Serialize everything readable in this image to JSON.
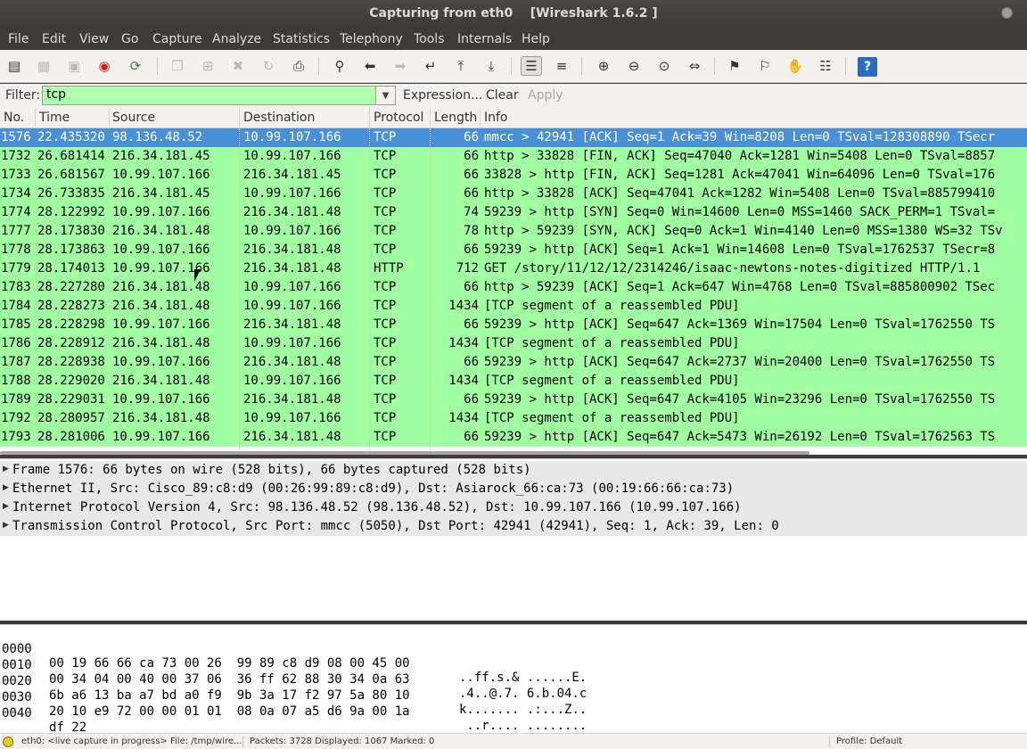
{
  "window": {
    "title": "Capturing from eth0    [Wireshark 1.6.2 ]"
  },
  "menu": [
    "File",
    "Edit",
    "View",
    "Go",
    "Capture",
    "Analyze",
    "Statistics",
    "Telephony",
    "Tools",
    "Internals",
    "Help"
  ],
  "toolbar": {
    "icons": [
      "interfaces-icon",
      "options-icon",
      "start-icon",
      "stop-icon",
      "restart-icon",
      "open-icon",
      "save-icon",
      "close-icon",
      "reload-icon",
      "print-icon",
      "find-icon",
      "back-icon",
      "forward-icon",
      "goto-icon",
      "first-icon",
      "last-icon",
      "colorize-icon",
      "autoscroll-icon",
      "zoom-in-icon",
      "zoom-out-icon",
      "zoom-normal-icon",
      "resize-columns-icon",
      "capture-filters-icon",
      "display-filters-icon",
      "coloring-rules-icon",
      "preferences-icon",
      "help-icon"
    ],
    "help_glyph": "?"
  },
  "filter": {
    "label": "Filter:",
    "value": "tcp",
    "expression": "Expression...",
    "clear": "Clear",
    "apply": "Apply"
  },
  "columns": [
    "No.",
    "Time",
    "Source",
    "Destination",
    "Protocol",
    "Length",
    "Info"
  ],
  "packets": [
    {
      "no": "1576",
      "time": "22.435320",
      "src": "98.136.48.52",
      "dst": "10.99.107.166",
      "proto": "TCP",
      "len": "66",
      "info": "mmcc > 42941 [ACK] Seq=1 Ack=39 Win=8208 Len=0 TSval=128308890 TSecr",
      "selected": true
    },
    {
      "no": "1732",
      "time": "26.681414",
      "src": "216.34.181.45",
      "dst": "10.99.107.166",
      "proto": "TCP",
      "len": "66",
      "info": "http > 33828 [FIN, ACK] Seq=47040 Ack=1281 Win=5408 Len=0 TSval=8857"
    },
    {
      "no": "1733",
      "time": "26.681567",
      "src": "10.99.107.166",
      "dst": "216.34.181.45",
      "proto": "TCP",
      "len": "66",
      "info": "33828 > http [FIN, ACK] Seq=1281 Ack=47041 Win=64096 Len=0 TSval=176"
    },
    {
      "no": "1734",
      "time": "26.733835",
      "src": "216.34.181.45",
      "dst": "10.99.107.166",
      "proto": "TCP",
      "len": "66",
      "info": "http > 33828 [ACK] Seq=47041 Ack=1282 Win=5408 Len=0 TSval=885799410"
    },
    {
      "no": "1774",
      "time": "28.122992",
      "src": "10.99.107.166",
      "dst": "216.34.181.48",
      "proto": "TCP",
      "len": "74",
      "info": "59239 > http [SYN] Seq=0 Win=14600 Len=0 MSS=1460 SACK_PERM=1 TSval="
    },
    {
      "no": "1777",
      "time": "28.173830",
      "src": "216.34.181.48",
      "dst": "10.99.107.166",
      "proto": "TCP",
      "len": "78",
      "info": "http > 59239 [SYN, ACK] Seq=0 Ack=1 Win=4140 Len=0 MSS=1380 WS=32 TSv"
    },
    {
      "no": "1778",
      "time": "28.173863",
      "src": "10.99.107.166",
      "dst": "216.34.181.48",
      "proto": "TCP",
      "len": "66",
      "info": "59239 > http [ACK] Seq=1 Ack=1 Win=14608 Len=0 TSval=1762537 TSecr=8"
    },
    {
      "no": "1779",
      "time": "28.174013",
      "src": "10.99.107.166",
      "dst": "216.34.181.48",
      "proto": "HTTP",
      "len": "712",
      "info": "GET /story/11/12/12/2314246/isaac-newtons-notes-digitized HTTP/1.1"
    },
    {
      "no": "1783",
      "time": "28.227280",
      "src": "216.34.181.48",
      "dst": "10.99.107.166",
      "proto": "TCP",
      "len": "66",
      "info": "http > 59239 [ACK] Seq=1 Ack=647 Win=4768 Len=0 TSval=885800902 TSec"
    },
    {
      "no": "1784",
      "time": "28.228273",
      "src": "216.34.181.48",
      "dst": "10.99.107.166",
      "proto": "TCP",
      "len": "1434",
      "info": "[TCP segment of a reassembled PDU]"
    },
    {
      "no": "1785",
      "time": "28.228298",
      "src": "10.99.107.166",
      "dst": "216.34.181.48",
      "proto": "TCP",
      "len": "66",
      "info": "59239 > http [ACK] Seq=647 Ack=1369 Win=17504 Len=0 TSval=1762550 TS"
    },
    {
      "no": "1786",
      "time": "28.228912",
      "src": "216.34.181.48",
      "dst": "10.99.107.166",
      "proto": "TCP",
      "len": "1434",
      "info": "[TCP segment of a reassembled PDU]"
    },
    {
      "no": "1787",
      "time": "28.228938",
      "src": "10.99.107.166",
      "dst": "216.34.181.48",
      "proto": "TCP",
      "len": "66",
      "info": "59239 > http [ACK] Seq=647 Ack=2737 Win=20400 Len=0 TSval=1762550 TS"
    },
    {
      "no": "1788",
      "time": "28.229020",
      "src": "216.34.181.48",
      "dst": "10.99.107.166",
      "proto": "TCP",
      "len": "1434",
      "info": "[TCP segment of a reassembled PDU]"
    },
    {
      "no": "1789",
      "time": "28.229031",
      "src": "10.99.107.166",
      "dst": "216.34.181.48",
      "proto": "TCP",
      "len": "66",
      "info": "59239 > http [ACK] Seq=647 Ack=4105 Win=23296 Len=0 TSval=1762550 TS"
    },
    {
      "no": "1792",
      "time": "28.280957",
      "src": "216.34.181.48",
      "dst": "10.99.107.166",
      "proto": "TCP",
      "len": "1434",
      "info": "[TCP segment of a reassembled PDU]"
    },
    {
      "no": "1793",
      "time": "28.281006",
      "src": "10.99.107.166",
      "dst": "216.34.181.48",
      "proto": "TCP",
      "len": "66",
      "info": "59239 > http [ACK] Seq=647 Ack=5473 Win=26192 Len=0 TSval=1762563 TS"
    }
  ],
  "details": [
    "Frame 1576: 66 bytes on wire (528 bits), 66 bytes captured (528 bits)",
    "Ethernet II, Src: Cisco_89:c8:d9 (00:26:99:89:c8:d9), Dst: Asiarock_66:ca:73 (00:19:66:66:ca:73)",
    "Internet Protocol Version 4, Src: 98.136.48.52 (98.136.48.52), Dst: 10.99.107.166 (10.99.107.166)",
    "Transmission Control Protocol, Src Port: mmcc (5050), Dst Port: 42941 (42941), Seq: 1, Ack: 39, Len: 0"
  ],
  "hex": [
    {
      "off": "0000",
      "hex": "00 19 66 66 ca 73 00 26  99 89 c8 d9 08 00 45 00",
      "ascii": "..ff.s.& ......E."
    },
    {
      "off": "0010",
      "hex": "00 34 04 00 40 00 37 06  36 ff 62 88 30 34 0a 63",
      "ascii": ".4..@.7. 6.b.04.c"
    },
    {
      "off": "0020",
      "hex": "6b a6 13 ba a7 bd a0 f9  9b 3a 17 f2 97 5a 80 10",
      "ascii": "k....... .:...Z.."
    },
    {
      "off": "0030",
      "hex": "20 10 e9 72 00 00 01 01  08 0a 07 a5 d6 9a 00 1a",
      "ascii": " ..r.... ........"
    },
    {
      "off": "0040",
      "hex": "df 22",
      "ascii": ".\""
    }
  ],
  "status": {
    "capture": "eth0: <live capture in progress> File: /tmp/wire...",
    "packets": "Packets: 3728 Displayed: 1067 Marked: 0",
    "profile": "Profile: Default"
  }
}
